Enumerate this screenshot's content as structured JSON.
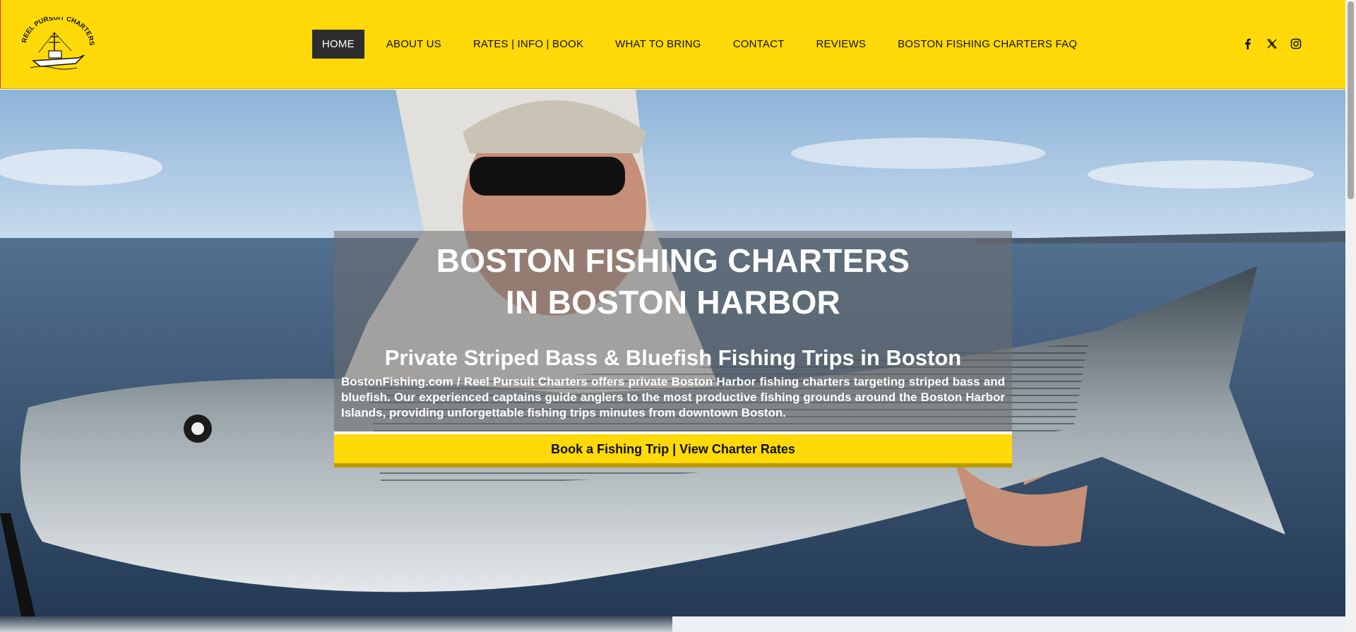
{
  "brand": {
    "logo_text": "REEL PURSUIT CHARTERS",
    "accent_color": "#ffd908"
  },
  "nav": {
    "items": [
      {
        "label": "HOME",
        "active": true
      },
      {
        "label": "ABOUT US",
        "active": false
      },
      {
        "label": "RATES | INFO | BOOK",
        "active": false
      },
      {
        "label": "WHAT TO BRING",
        "active": false
      },
      {
        "label": "CONTACT",
        "active": false
      },
      {
        "label": "REVIEWS",
        "active": false
      },
      {
        "label": "BOSTON FISHING CHARTERS FAQ",
        "active": false
      }
    ]
  },
  "social": [
    "facebook-icon",
    "x-twitter-icon",
    "instagram-icon"
  ],
  "hero": {
    "title_line1": "BOSTON FISHING CHARTERS",
    "title_line2": "IN BOSTON HARBOR",
    "subtitle": "Private Striped Bass & Bluefish Fishing Trips in Boston",
    "description": "BostonFishing.com / Reel Pursuit Charters offers private Boston Harbor fishing charters targeting striped bass and bluefish. Our experienced captains guide anglers to the most productive fishing grounds around the Boston Harbor Islands, providing unforgettable fishing trips minutes from downtown Boston.",
    "cta_label": "Book a Fishing Trip | View Charter Rates"
  }
}
